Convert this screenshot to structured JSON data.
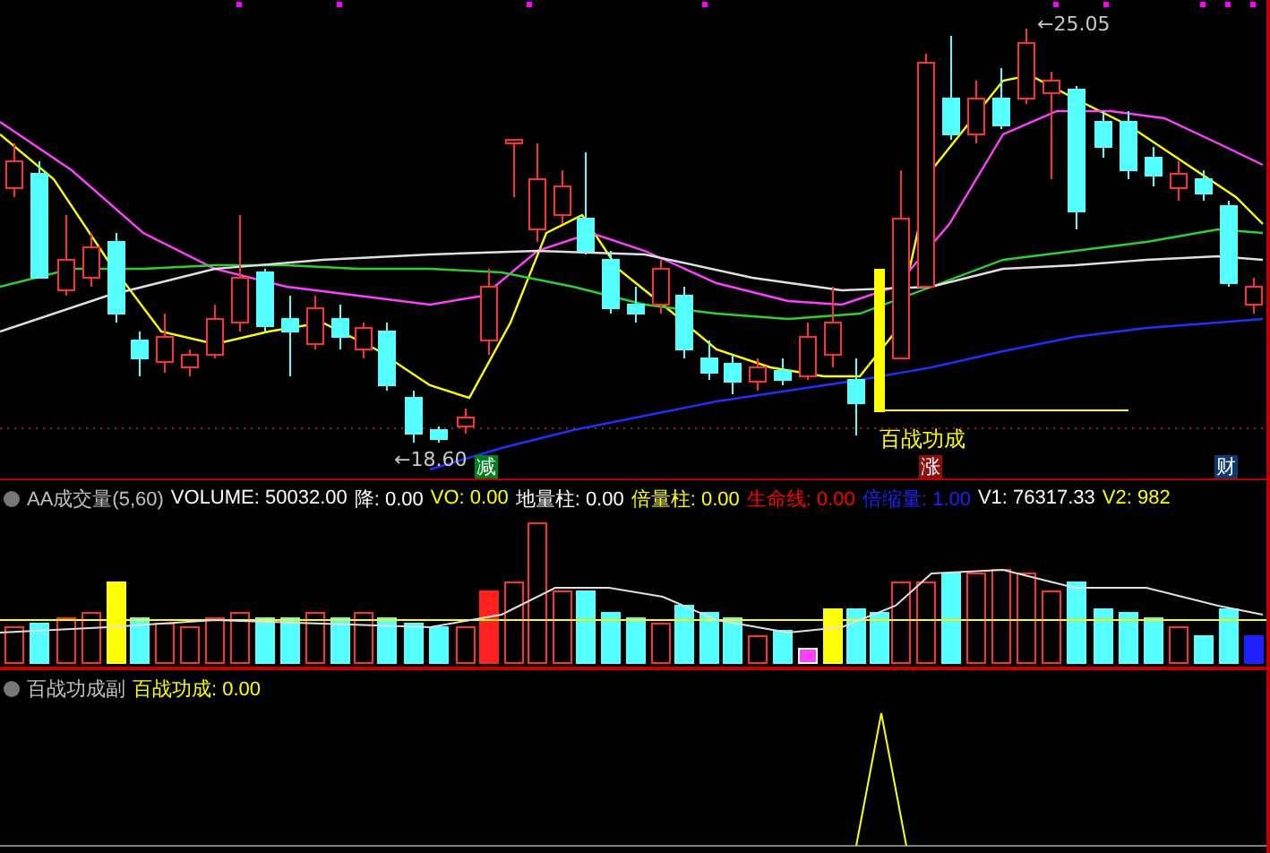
{
  "main_chart": {
    "high_label": "←25.05",
    "low_label": "←18.60",
    "signal_label": "百战功成",
    "markers": [
      {
        "text": "减",
        "color": "#00801e"
      },
      {
        "text": "涨",
        "color": "#8a1010"
      },
      {
        "text": "财",
        "color": "#0e3a6e"
      }
    ]
  },
  "volume_panel": {
    "indicators": [
      {
        "label": "AA成交量(5,60)",
        "color": "#c0c0c0"
      },
      {
        "label": "VOLUME: 50032.00",
        "color": "#ffffff"
      },
      {
        "label": "降: 0.00",
        "color": "#ffffff"
      },
      {
        "label": "VO: 0.00",
        "color": "#ffff00"
      },
      {
        "label": "地量柱: 0.00",
        "color": "#ffffff"
      },
      {
        "label": "倍量柱: 0.00",
        "color": "#ffff00"
      },
      {
        "label": "生命线: 0.00",
        "color": "#ff0000"
      },
      {
        "label": "倍缩量: 1.00",
        "color": "#2020ff"
      },
      {
        "label": "V1: 76317.33",
        "color": "#ffffff"
      },
      {
        "label": "V2: 982",
        "color": "#ffff00"
      }
    ]
  },
  "sub_panel": {
    "indicators": [
      {
        "label": "百战功成副",
        "color": "#c0c0c0"
      },
      {
        "label": "百战功成: 0.00",
        "color": "#ffff00"
      }
    ]
  }
}
